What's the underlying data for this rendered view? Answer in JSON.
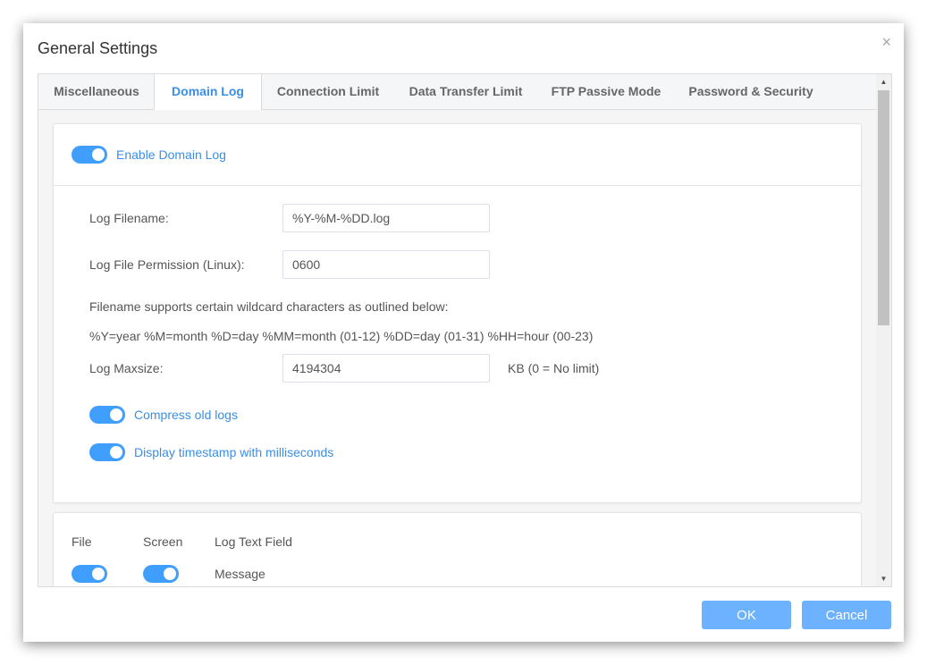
{
  "dialog": {
    "title": "General Settings",
    "close_symbol": "×"
  },
  "tabs": [
    {
      "label": "Miscellaneous"
    },
    {
      "label": "Domain Log"
    },
    {
      "label": "Connection Limit"
    },
    {
      "label": "Data Transfer Limit"
    },
    {
      "label": "FTP Passive Mode"
    },
    {
      "label": "Password & Security"
    }
  ],
  "active_tab": "Domain Log",
  "domain_log": {
    "enable_label": "Enable Domain Log",
    "enable_on": true,
    "log_filename_label": "Log Filename:",
    "log_filename_value": "%Y-%M-%DD.log",
    "permission_label": "Log File Permission (Linux):",
    "permission_value": "0600",
    "wildcard_note": "Filename supports certain wildcard characters as outlined below:",
    "wildcard_list": "%Y=year %M=month %D=day %MM=month (01-12) %DD=day (01-31) %HH=hour (00-23)",
    "maxsize_label": "Log Maxsize:",
    "maxsize_value": "4194304",
    "maxsize_unit": "KB (0 = No limit)",
    "compress_label": "Compress old logs",
    "compress_on": true,
    "timestamp_label": "Display timestamp with milliseconds",
    "timestamp_on": true
  },
  "log_fields": {
    "headers": [
      "File",
      "Screen",
      "Log Text Field"
    ],
    "rows": [
      {
        "file_on": true,
        "screen_on": true,
        "field": "Message"
      }
    ]
  },
  "buttons": {
    "ok": "OK",
    "cancel": "Cancel"
  },
  "scrollbar": {
    "up_symbol": "▲",
    "down_symbol": "▼"
  },
  "colors": {
    "accent": "#409eff",
    "accent_text": "#3a8ee6",
    "button": "#6cb2ff"
  }
}
